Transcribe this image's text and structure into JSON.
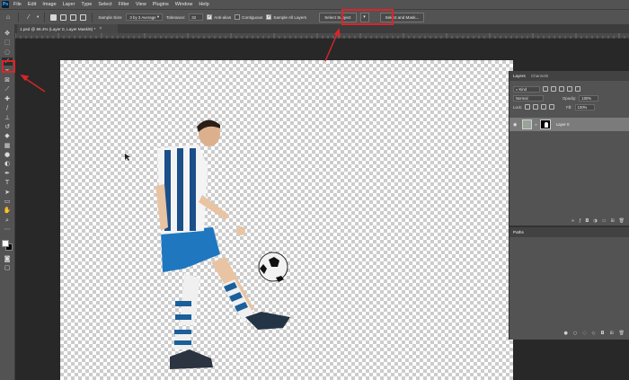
{
  "app": {
    "logo": "Ps",
    "menu": [
      "File",
      "Edit",
      "Image",
      "Layer",
      "Type",
      "Select",
      "Filter",
      "View",
      "Plugins",
      "Window",
      "Help"
    ]
  },
  "options_bar": {
    "sample_size_label": "Sample Size:",
    "sample_size_value": "3 by 3 Average",
    "tolerance_label": "Tolerance:",
    "tolerance_value": "32",
    "anti_alias_label": "Anti-alias",
    "contiguous_label": "Contiguous",
    "sample_all_layers_label": "Sample All Layers",
    "select_subject_label": "Select Subject",
    "select_and_mask_label": "Select and Mask..."
  },
  "document": {
    "tab_title": "1.psd @ 66.4% (Layer 0, Layer Mask/8) *",
    "close_glyph": "×"
  },
  "layers_panel": {
    "tabs": [
      "Layers",
      "Channels"
    ],
    "active_tab": "Layers",
    "filter_label": "Kind",
    "blend_mode": "Normal",
    "opacity_label": "Opacity:",
    "opacity_value": "100%",
    "lock_label": "Lock:",
    "fill_label": "Fill:",
    "fill_value": "100%",
    "layers": [
      {
        "name": "Layer 0",
        "visible": true,
        "selected": true
      }
    ]
  },
  "paths_panel": {
    "title": "Paths"
  },
  "colors": {
    "foreground": "#ffffff",
    "background": "#000000",
    "highlight": "#d9252a"
  },
  "icons": {
    "tools": [
      "move-tool",
      "marquee-tool",
      "lasso-tool",
      "magic-wand-tool",
      "crop-tool",
      "frame-tool",
      "eyedropper-tool",
      "healing-brush-tool",
      "brush-tool",
      "clone-stamp-tool",
      "history-brush-tool",
      "eraser-tool",
      "gradient-tool",
      "blur-tool",
      "dodge-tool",
      "pen-tool",
      "type-tool",
      "path-selection-tool",
      "rectangle-tool",
      "hand-tool",
      "zoom-tool"
    ]
  }
}
